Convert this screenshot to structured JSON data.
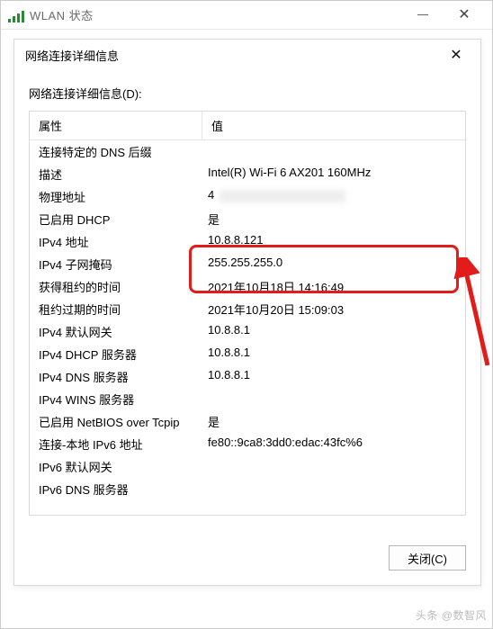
{
  "outer_window": {
    "title": "WLAN 状态"
  },
  "inner_window": {
    "title": "网络连接详细信息"
  },
  "label_top": "网络连接详细信息(D):",
  "headers": {
    "property": "属性",
    "value": "值"
  },
  "rows": [
    {
      "k": "连接特定的 DNS 后缀",
      "v": ""
    },
    {
      "k": "描述",
      "v": "Intel(R) Wi-Fi 6 AX201 160MHz"
    },
    {
      "k": "物理地址",
      "v": "4",
      "redacted": true
    },
    {
      "k": "已启用 DHCP",
      "v": "是"
    },
    {
      "k": "IPv4 地址",
      "v": "10.8.8.121"
    },
    {
      "k": "IPv4 子网掩码",
      "v": "255.255.255.0"
    },
    {
      "k": "获得租约的时间",
      "v": "2021年10月18日 14:16:49"
    },
    {
      "k": "租约过期的时间",
      "v": "2021年10月20日 15:09:03"
    },
    {
      "k": "IPv4 默认网关",
      "v": "10.8.8.1"
    },
    {
      "k": "IPv4 DHCP 服务器",
      "v": "10.8.8.1"
    },
    {
      "k": "IPv4 DNS 服务器",
      "v": "10.8.8.1"
    },
    {
      "k": "IPv4 WINS 服务器",
      "v": ""
    },
    {
      "k": "已启用 NetBIOS over Tcpip",
      "v": "是"
    },
    {
      "k": "连接-本地 IPv6 地址",
      "v": "fe80::9ca8:3dd0:edac:43fc%6"
    },
    {
      "k": "IPv6 默认网关",
      "v": ""
    },
    {
      "k": "IPv6 DNS 服务器",
      "v": ""
    }
  ],
  "close_button": "关闭(C)",
  "watermark": "头条 @数智风"
}
